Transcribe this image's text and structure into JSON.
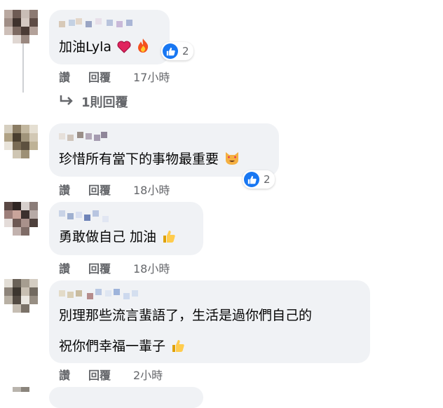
{
  "comments": [
    {
      "text_lines": [
        "加油Lyla"
      ],
      "emojis": [
        "heart-emoji",
        "fire-emoji"
      ],
      "reaction_count": "2",
      "actions": {
        "like": "讚",
        "reply": "回覆",
        "time": "17小時"
      },
      "view_replies": "1則回覆"
    },
    {
      "text_lines": [
        "珍惜所有當下的事物最重要"
      ],
      "emojis": [
        "heart-eyes-cat-emoji"
      ],
      "reaction_count": "2",
      "actions": {
        "like": "讚",
        "reply": "回覆",
        "time": "18小時"
      }
    },
    {
      "text_lines": [
        "勇敢做自己 加油"
      ],
      "emojis": [
        "thumbs-up-emoji"
      ],
      "actions": {
        "like": "讚",
        "reply": "回覆",
        "time": "18小時"
      }
    },
    {
      "text_lines": [
        "別理那些流言蜚語了，生活是過你們自己的",
        "祝你們幸福一輩子"
      ],
      "emojis": [
        "thumbs-up-emoji"
      ],
      "actions": {
        "like": "讚",
        "reply": "回覆",
        "time": "2小時"
      }
    }
  ],
  "colors": {
    "bubble": "#f0f2f5",
    "like_blue": "#1877f2",
    "meta_gray": "#65676b"
  }
}
